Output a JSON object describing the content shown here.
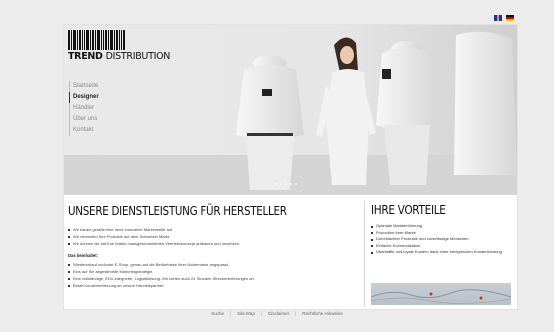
{
  "languages": [
    "en-flag-icon",
    "de-flag-icon"
  ],
  "logo": {
    "brand": "TREND",
    "brand_light": "DISTRIBUTION"
  },
  "nav": {
    "items": [
      {
        "label": "Startseite",
        "active": false
      },
      {
        "label": "Designer",
        "active": true
      },
      {
        "label": "Händler",
        "active": false
      },
      {
        "label": "Über uns",
        "active": false
      },
      {
        "label": "Kontakt",
        "active": false
      }
    ]
  },
  "main": {
    "headline": "UNSERE DIENSTLEISTUNG FÜR HERSTELLER",
    "intro": [
      "Wir bauen gerade eine neue innovative Markenseite auf.",
      "Wir verbinden Ihre Produkte auf dem Schweizer Markt.",
      "Wir können wir auf Ihre Marke massgeschneidertes Vertriebskonzept aufbauen und umsetzen."
    ],
    "subhead": "Das beinhaltet:",
    "details": [
      "Wiedererkauf und/oder E-Shop, genau auf die Bedürfnisse Ihrer Modemarke angepasst.",
      "Eins auf Sie abgestimmte Marketingstrategie.",
      "Eins vollständige, EDV-integrierte, Logistiklösung. Wir bieten auch 24 Stunden Streckenlieferungen an.",
      "Beste Kundenbetreuung an unsere Handelspartner."
    ]
  },
  "sidebar": {
    "title": "IHRE VORTEILE",
    "items": [
      "Optimale Markteinführung",
      "Promotion Ihrer Marke",
      "Durchdachter Prozesse und zuverlässige Menschen",
      "Einfache Kommunikation",
      "Überstätte und loyale Kunden dank einer erfolgreichen Kundenbindung"
    ]
  },
  "footer": {
    "links": [
      "Suche",
      "Site Map",
      "Disclaimer",
      "Rechtliche Hinweise"
    ]
  }
}
